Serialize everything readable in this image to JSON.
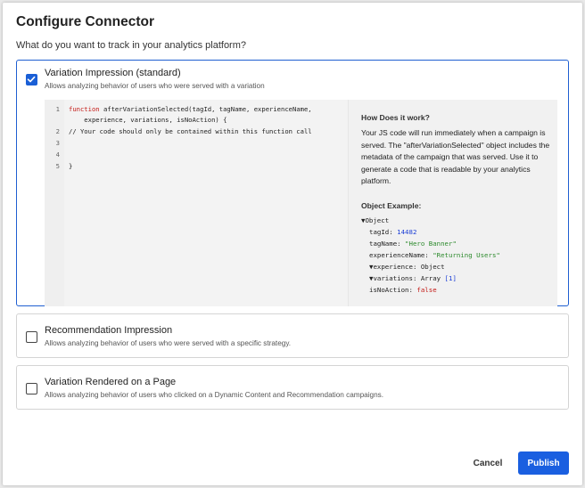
{
  "dialog": {
    "title": "Configure Connector",
    "subtitle": "What do you want to track in your analytics platform?"
  },
  "options": [
    {
      "label": "Variation Impression (standard)",
      "description": "Allows analyzing behavior of users who were served with a variation",
      "checked": true
    },
    {
      "label": "Recommendation Impression",
      "description": "Allows analyzing behavior of users who were served with a specific strategy.",
      "checked": false
    },
    {
      "label": "Variation Rendered on a Page",
      "description": "Allows analyzing behavior of users who clicked on a Dynamic Content and Recommendation campaigns.",
      "checked": false
    }
  ],
  "code": {
    "lines": [
      {
        "n": "1",
        "keyword": "function",
        "rest": " afterVariationSelected(tagId, tagName, experienceName,"
      },
      {
        "n": "",
        "text": "    experience, variations, isNoAction) {"
      },
      {
        "n": "2",
        "comment": "// Your code should only be contained within this function call"
      },
      {
        "n": "3",
        "text": ""
      },
      {
        "n": "4",
        "text": ""
      },
      {
        "n": "5",
        "text": "}"
      }
    ]
  },
  "info": {
    "title": "How Does it work?",
    "body": "Your JS code will run immediately when a campaign is served. The \"afterVariationSelected\" object includes the metadata of the campaign that was served. Use it to generate a code that is readable by your analytics platform.",
    "object_title": "Object Example:",
    "object": {
      "root": "▼Object",
      "tagId_key": "tagId: ",
      "tagId_val": "14482",
      "tagName_key": "tagName: ",
      "tagName_val": "\"Hero Banner\"",
      "experienceName_key": "experienceName: ",
      "experienceName_val": "\"Returning Users\"",
      "experience": "▼experience: Object",
      "variations_key": "▼variations: Array ",
      "variations_val": "[1]",
      "isNoAction_key": "isNoAction: ",
      "isNoAction_val": "false"
    }
  },
  "footer": {
    "cancel_label": "Cancel",
    "publish_label": "Publish"
  },
  "colors": {
    "accent": "#1a5fe0",
    "selected_border": "#1f5fd1",
    "keyword": "#c41a16",
    "comment": "#2e8b2e",
    "number": "#1c3fd6"
  }
}
